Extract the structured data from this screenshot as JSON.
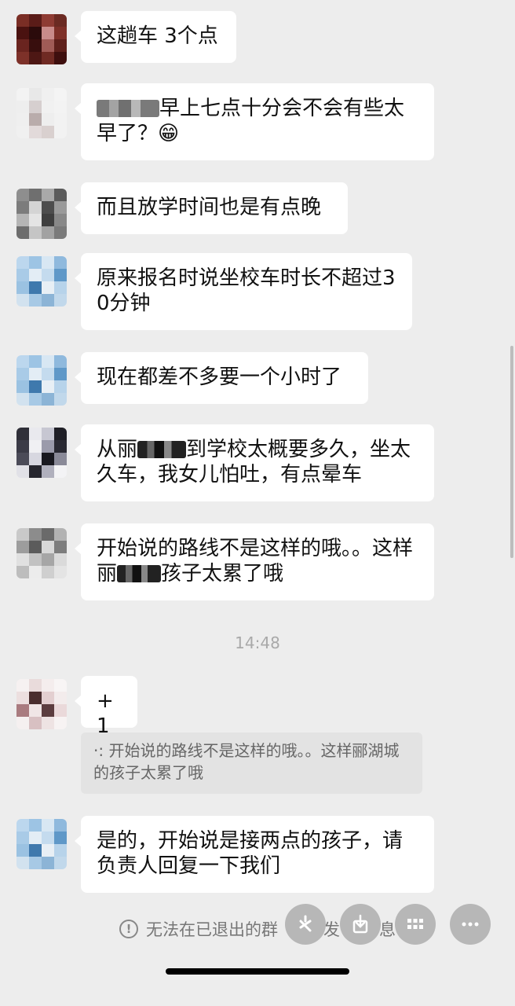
{
  "messages": [
    {
      "text": "这趟车 3个点"
    },
    {
      "text_after": "早上七点十分会不会有些太早了？",
      "emoji": "😁"
    },
    {
      "text": "而且放学时间也是有点晚"
    },
    {
      "text": "原来报名时说坐校车时长不超过30分钟"
    },
    {
      "text": "现在都差不多要一个小时了"
    },
    {
      "text_before": "从丽",
      "text_after": "到学校太概要多久，坐太久车，我女儿怕吐，有点晕车"
    },
    {
      "text_line1": "开始说的路线不是这样的哦。。这",
      "text_before": "样丽",
      "text_after": "孩子太累了哦"
    },
    {
      "text": "+1"
    },
    {
      "text": "是的，开始说是接两点的孩子，请负责人回复一下我们"
    }
  ],
  "timestamp": "14:48",
  "quote": {
    "prefix": "·:",
    "text": "开始说的路线不是这样的哦。。这样郦湖城的孩子太累了哦"
  },
  "notice": {
    "text_before": "无法在已退出的群",
    "text_mid": "发",
    "text_after": "息"
  },
  "colors": {
    "background": "#ededed",
    "bubble": "#ffffff",
    "quote_bg": "#e3e3e3",
    "timestamp": "#a9a9a9"
  },
  "icons": [
    "info-icon",
    "restaurant-icon",
    "download-icon",
    "grid-icon",
    "more-icon"
  ]
}
